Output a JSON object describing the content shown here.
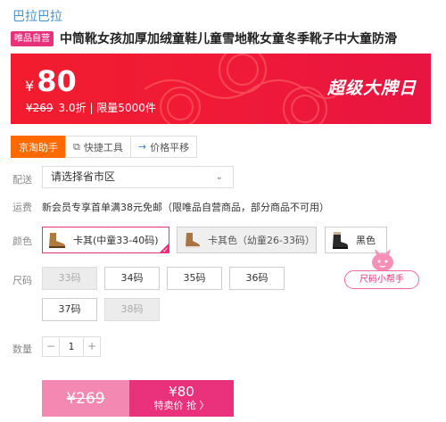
{
  "brand": "巴拉巴拉",
  "product": {
    "tag": "唯品自营",
    "title": "中筒靴女孩加厚加绒童鞋儿童雪地靴女童冬季靴子中大童防滑"
  },
  "banner": {
    "currency": "¥",
    "price": "80",
    "original_price": "¥269",
    "discount_limit": "3.0折 | 限量5000件",
    "promo_text": "超级大牌日"
  },
  "tools": [
    {
      "label": "京淘助手",
      "icon": "none"
    },
    {
      "label": "快捷工具",
      "icon": "copy-icon"
    },
    {
      "label": "价格平移",
      "icon": "arrow-right-icon"
    }
  ],
  "delivery": {
    "label": "配送",
    "placeholder_value": "请选择省市区"
  },
  "shipping": {
    "label": "运费",
    "text": "新会员专享首单满38元免邮（限唯品自营商品，部分商品不可用）"
  },
  "colors": {
    "label": "颜色",
    "options": [
      {
        "label": "卡其(中童33-40码)",
        "state": "selected"
      },
      {
        "label": "卡其色（幼童26-33码）",
        "state": "disabled"
      },
      {
        "label": "黑色",
        "state": "normal"
      }
    ]
  },
  "sizes": {
    "label": "尺码",
    "options": [
      {
        "label": "33码",
        "state": "disabled"
      },
      {
        "label": "34码",
        "state": "normal"
      },
      {
        "label": "35码",
        "state": "normal"
      },
      {
        "label": "36码",
        "state": "normal"
      },
      {
        "label": "37码",
        "state": "normal"
      },
      {
        "label": "38码",
        "state": "disabled"
      }
    ],
    "helper": "尺码小帮手"
  },
  "quantity": {
    "label": "数量",
    "minus": "−",
    "value": "1",
    "plus": "+"
  },
  "buy": {
    "original_price": "¥269",
    "price": "¥80",
    "label": "特卖价 抢 〉"
  },
  "colors_theme": {
    "accent": "#e9317c",
    "banner_red": "#f21c2e",
    "tool_active": "#ff6a00",
    "link_blue": "#4a90c8"
  }
}
